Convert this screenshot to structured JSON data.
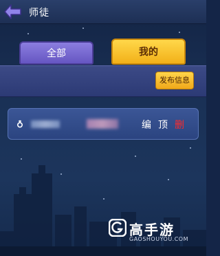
{
  "header": {
    "title": "师徒"
  },
  "tabs": [
    {
      "label": "全部",
      "active": false
    },
    {
      "label": "我的",
      "active": true
    }
  ],
  "actions": {
    "post_label": "发布信息"
  },
  "list": [
    {
      "edit_label": "编",
      "top_label": "顶",
      "delete_label": "删"
    }
  ],
  "watermark": {
    "brand_cn": "高手游",
    "brand_en": "GAOSHOUYOU.COM"
  },
  "colors": {
    "background": "#1a3156",
    "tab_inactive": "#6d5ecb",
    "tab_active": "#f5b92a",
    "row_bg": "#2f4a88",
    "delete_text": "#ff2a2a"
  },
  "icons": {
    "back": "back-arrow-icon",
    "gender": "gender-icon",
    "brand": "gaoshouyou-logo-icon"
  }
}
